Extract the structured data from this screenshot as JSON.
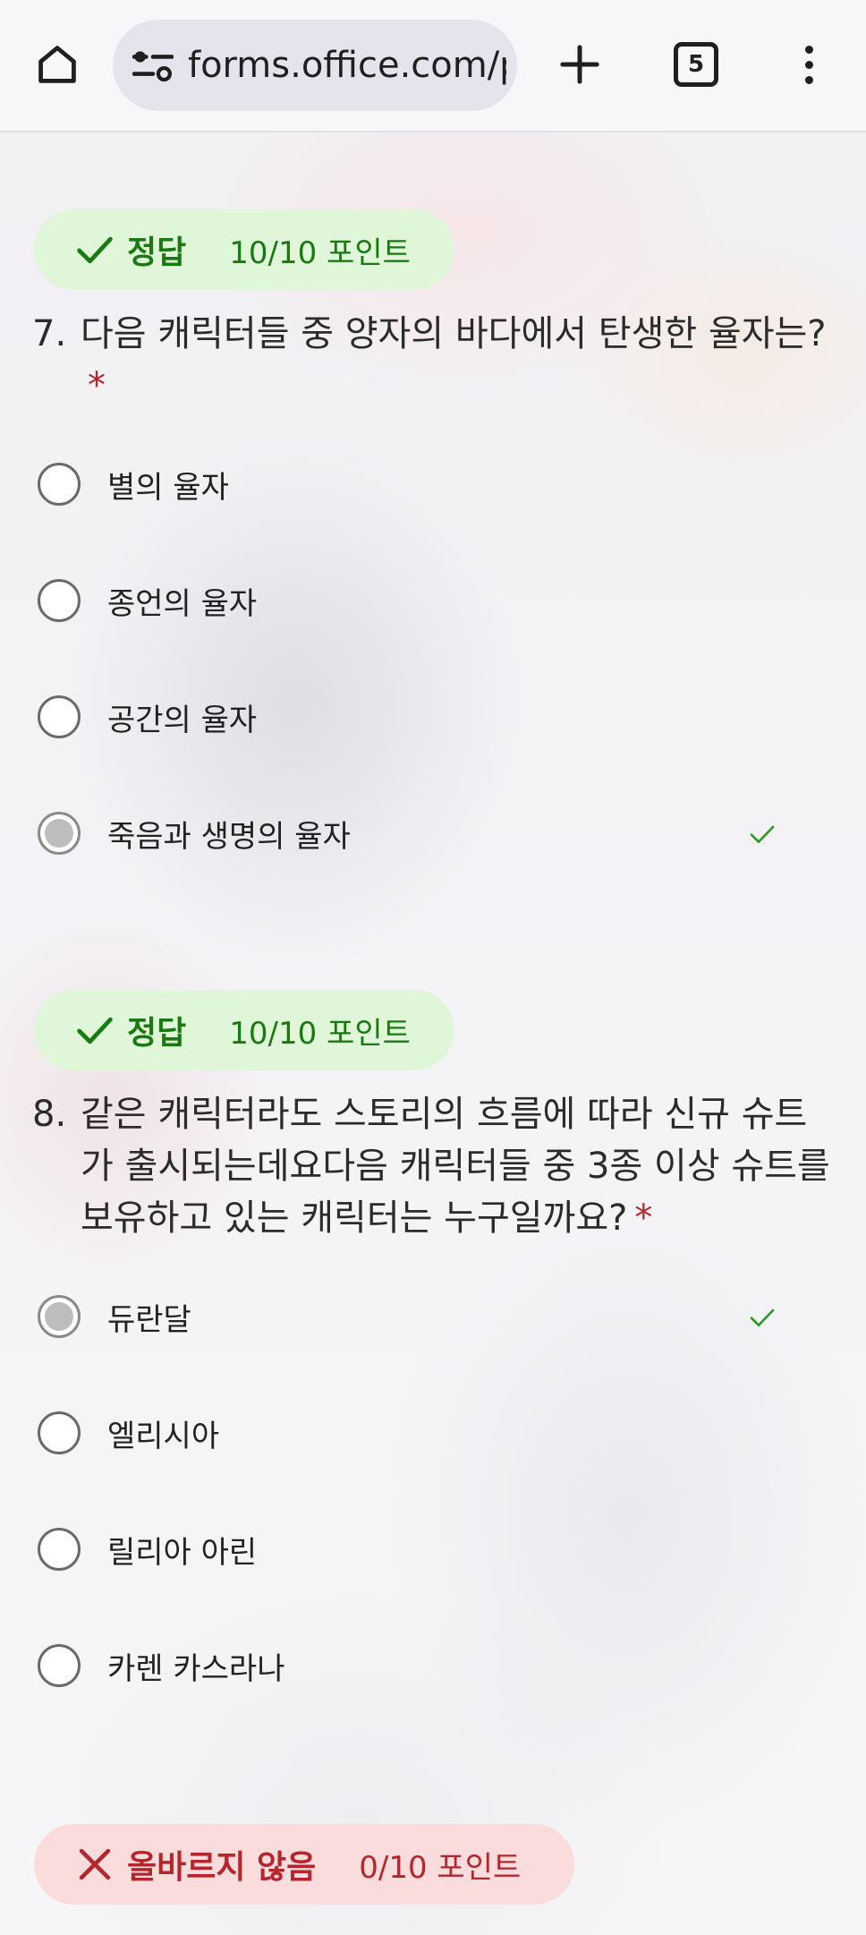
{
  "browser": {
    "url": "forms.office.com/p",
    "tab_count": "5",
    "icons": {
      "home": "home-icon",
      "site_info": "tune-icon",
      "new_tab": "plus-icon",
      "tabs": "tab-switcher-icon",
      "menu": "more-vert-icon"
    }
  },
  "colors": {
    "correct_bg": "#dff6d8",
    "correct_text": "#1a7a12",
    "wrong_bg": "#fbdcdc",
    "wrong_text": "#b4262c",
    "required_star": "#b4262c",
    "check_mark": "#2e9a25"
  },
  "questions": [
    {
      "result": "correct",
      "badge_label": "정답",
      "badge_points": "10/10 포인트",
      "number": "7.",
      "text": "다음 캐릭터들 중 양자의 바다에서 탄생한 율자는?",
      "required": "*",
      "options": [
        {
          "label": "별의 율자",
          "selected": false,
          "correct": false
        },
        {
          "label": "종언의 율자",
          "selected": false,
          "correct": false
        },
        {
          "label": "공간의 율자",
          "selected": false,
          "correct": false
        },
        {
          "label": "죽음과 생명의 율자",
          "selected": true,
          "correct": true
        }
      ]
    },
    {
      "result": "correct",
      "badge_label": "정답",
      "badge_points": "10/10 포인트",
      "number": "8.",
      "text": "같은 캐릭터라도 스토리의 흐름에 따라 신규 슈트가 출시되는데요다음 캐릭터들 중 3종 이상 슈트를 보유하고 있는 캐릭터는 누구일까요?",
      "required": "*",
      "options": [
        {
          "label": "듀란달",
          "selected": true,
          "correct": true
        },
        {
          "label": "엘리시아",
          "selected": false,
          "correct": false
        },
        {
          "label": "릴리아 아린",
          "selected": false,
          "correct": false
        },
        {
          "label": "카렌 카스라나",
          "selected": false,
          "correct": false
        }
      ]
    },
    {
      "result": "wrong",
      "badge_label": "올바르지 않음",
      "badge_points": "0/10 포인트"
    }
  ]
}
